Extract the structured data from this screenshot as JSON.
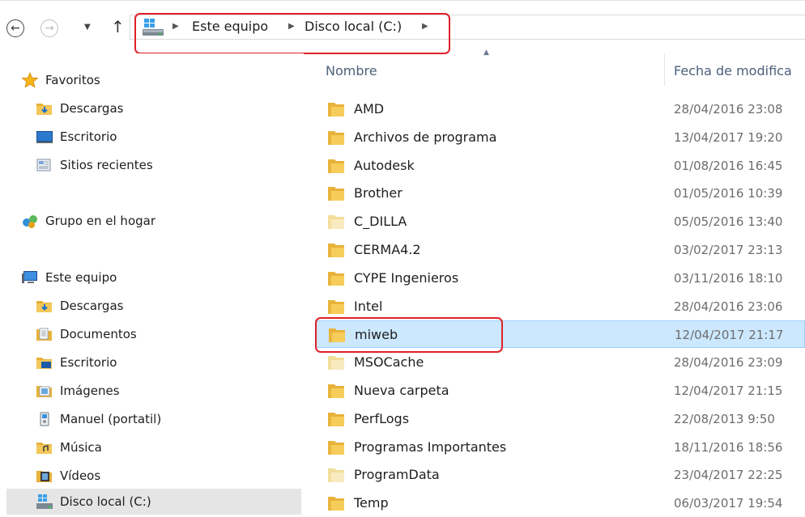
{
  "toolbar": {
    "back_glyph": "←",
    "forward_glyph": "→",
    "recent_glyph": "▼",
    "up_glyph": "↑"
  },
  "breadcrumb": {
    "items": [
      "Este equipo",
      "Disco local (C:)"
    ],
    "separator": "▶"
  },
  "columns": {
    "name": "Nombre",
    "date": "Fecha de modifica"
  },
  "nav": {
    "favorites": {
      "label": "Favoritos",
      "items": [
        "Descargas",
        "Escritorio",
        "Sitios recientes"
      ]
    },
    "homegroup": "Grupo en el hogar",
    "this_pc": {
      "label": "Este equipo",
      "items": [
        "Descargas",
        "Documentos",
        "Escritorio",
        "Imágenes",
        "Manuel (portatil)",
        "Música",
        "Vídeos",
        "Disco local (C:)"
      ]
    }
  },
  "files": [
    {
      "name": "AMD",
      "date": "28/04/2016 23:08"
    },
    {
      "name": "Archivos de programa",
      "date": "13/04/2017 19:20"
    },
    {
      "name": "Autodesk",
      "date": "01/08/2016 16:45"
    },
    {
      "name": "Brother",
      "date": "01/05/2016 10:39"
    },
    {
      "name": "C_DILLA",
      "date": "05/05/2016 13:40"
    },
    {
      "name": "CERMA4.2",
      "date": "03/02/2017 23:13"
    },
    {
      "name": "CYPE Ingenieros",
      "date": "03/11/2016 18:10"
    },
    {
      "name": "Intel",
      "date": "28/04/2016 23:06"
    },
    {
      "name": "miweb",
      "date": "12/04/2017 21:17"
    },
    {
      "name": "MSOCache",
      "date": "28/04/2016 23:09"
    },
    {
      "name": "Nueva carpeta",
      "date": "12/04/2017 21:15"
    },
    {
      "name": "PerfLogs",
      "date": "22/08/2013 9:50"
    },
    {
      "name": "Programas Importantes",
      "date": "18/11/2016 18:56"
    },
    {
      "name": "ProgramData",
      "date": "23/04/2017 22:25"
    },
    {
      "name": "Temp",
      "date": "06/03/2017 19:54"
    }
  ],
  "colors": {
    "selection_bg": "#cce8ff",
    "highlight_border": "#e0202a",
    "column_header_text": "#4c607a",
    "folder_yellow": "#e8b23a"
  }
}
